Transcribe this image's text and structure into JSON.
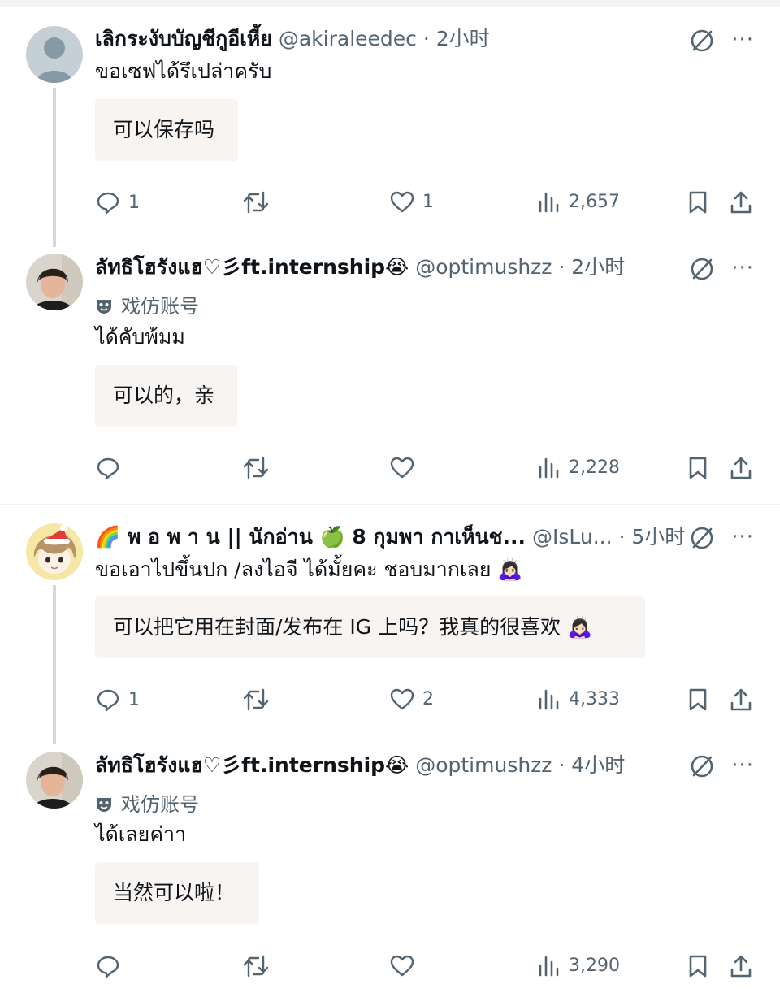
{
  "posts": [
    {
      "name": "เลิกระงับบัญชีกูอีเหี้ย",
      "handle": "@akiraleedec",
      "dot": "·",
      "time": "2小时",
      "parody": "",
      "text": "ขอเซฟได้รึเปล่าครับ",
      "translation": "可以保存吗",
      "replies": "1",
      "reposts": "",
      "likes": "1",
      "views": "2,657"
    },
    {
      "name": "ลัทธิโฮรังแฮ♡彡ft.internship😭",
      "handle": "@optimushzz",
      "dot": "·",
      "time": "2小时",
      "parody": "戏仿账号",
      "text": "ได้คับพ้มม",
      "translation": "可以的，亲",
      "replies": "",
      "reposts": "",
      "likes": "",
      "views": "2,228"
    },
    {
      "name": "🌈 พ อ พ า น || นักอ่าน 🍏 8 กุมพา กาเห็นช...",
      "handle": "@IsLu...",
      "dot": "·",
      "time": "5小时",
      "parody": "",
      "text": "ขอเอาไปขึ้นปก /ลงไอจี ได้มั้ยคะ ชอบมากเลย 🙇🏻‍♀️",
      "translation": "可以把它用在封面/发布在 IG 上吗？我真的很喜欢 🙇🏻‍♀️",
      "replies": "1",
      "reposts": "",
      "likes": "2",
      "views": "4,333"
    },
    {
      "name": "ลัทธิโฮรังแฮ♡彡ft.internship😭",
      "handle": "@optimushzz",
      "dot": "·",
      "time": "4小时",
      "parody": "戏仿账号",
      "text": "ได้เลยค่าา",
      "translation": "当然可以啦！",
      "replies": "",
      "reposts": "",
      "likes": "",
      "views": "3,290"
    }
  ],
  "icons": {
    "more": "···",
    "grok": "grok-icon",
    "reply": "reply-icon",
    "repost": "repost-icon",
    "like": "heart-icon",
    "views": "views-icon",
    "bookmark": "bookmark-icon",
    "share": "share-icon"
  },
  "colors": {
    "text": "#0f1419",
    "muted": "#536471",
    "thread_line": "#cfd9de",
    "translation_bg": "#f7f4f2"
  }
}
